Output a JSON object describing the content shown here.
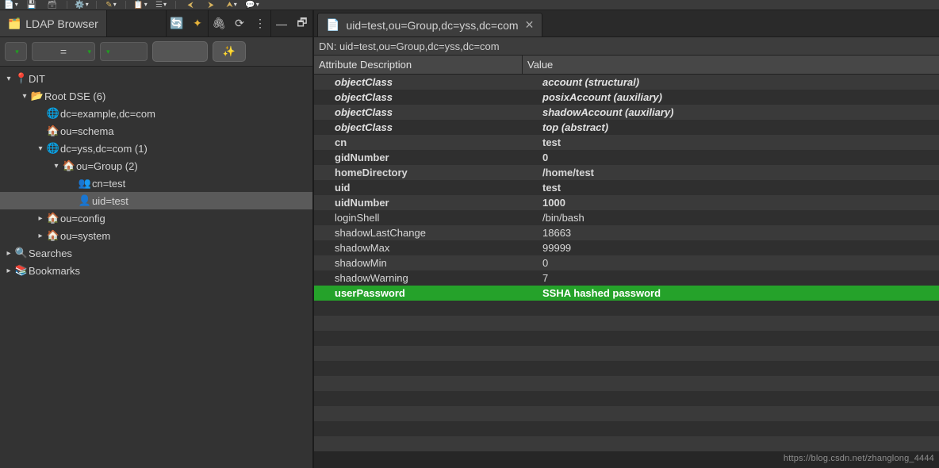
{
  "top_toolbar": {
    "icons": [
      "page",
      "save",
      "save-all",
      "gear",
      "pencil",
      "form",
      "align",
      "arrow-left",
      "arrow-right",
      "arrow-up",
      "chat"
    ]
  },
  "left": {
    "tab_title": "LDAP Browser",
    "tab_icons": {
      "refresh": "↻",
      "sync": "⇄",
      "link": "🖇",
      "cycle": "⟳",
      "menu": "⋮",
      "minimize": "—",
      "restore": "🗗"
    },
    "filter": {
      "eq_sign": "="
    }
  },
  "tree": [
    {
      "depth": 0,
      "tw": "v",
      "icon": "📍",
      "label": "DIT",
      "sel": false
    },
    {
      "depth": 1,
      "tw": "v",
      "icon": "📂",
      "label": "Root DSE (6)",
      "sel": false
    },
    {
      "depth": 2,
      "tw": "",
      "icon": "🌐",
      "label": "dc=example,dc=com",
      "sel": false
    },
    {
      "depth": 2,
      "tw": "",
      "icon": "🏠",
      "label": "ou=schema",
      "sel": false
    },
    {
      "depth": 2,
      "tw": "v",
      "icon": "🌐",
      "label": "dc=yss,dc=com (1)",
      "sel": false
    },
    {
      "depth": 3,
      "tw": "v",
      "icon": "🏠",
      "label": "ou=Group (2)",
      "sel": false
    },
    {
      "depth": 4,
      "tw": "",
      "icon": "👥",
      "label": "cn=test",
      "sel": false
    },
    {
      "depth": 4,
      "tw": "",
      "icon": "👤",
      "label": "uid=test",
      "sel": true
    },
    {
      "depth": 2,
      "tw": ">",
      "icon": "🏠",
      "label": "ou=config",
      "sel": false
    },
    {
      "depth": 2,
      "tw": ">",
      "icon": "🏠",
      "label": "ou=system",
      "sel": false
    },
    {
      "depth": 0,
      "tw": ">",
      "icon": "🔍",
      "label": "Searches",
      "sel": false
    },
    {
      "depth": 0,
      "tw": ">",
      "icon": "📚",
      "label": "Bookmarks",
      "sel": false
    }
  ],
  "editor": {
    "tab_icon": "📄",
    "tab_title": "uid=test,ou=Group,dc=yss,dc=com",
    "dn_label": "DN: uid=test,ou=Group,dc=yss,dc=com",
    "col_desc": "Attribute Description",
    "col_val": "Value"
  },
  "attrs": [
    {
      "k": "objectClass",
      "v": "account (structural)",
      "style": "bold italic"
    },
    {
      "k": "objectClass",
      "v": "posixAccount (auxiliary)",
      "style": "bold italic"
    },
    {
      "k": "objectClass",
      "v": "shadowAccount (auxiliary)",
      "style": "bold italic"
    },
    {
      "k": "objectClass",
      "v": "top (abstract)",
      "style": "bold italic"
    },
    {
      "k": "cn",
      "v": "test",
      "style": "bold"
    },
    {
      "k": "gidNumber",
      "v": "0",
      "style": "bold"
    },
    {
      "k": "homeDirectory",
      "v": "/home/test",
      "style": "bold"
    },
    {
      "k": "uid",
      "v": "test",
      "style": "bold"
    },
    {
      "k": "uidNumber",
      "v": "1000",
      "style": "bold"
    },
    {
      "k": "loginShell",
      "v": "/bin/bash",
      "style": ""
    },
    {
      "k": "shadowLastChange",
      "v": "18663",
      "style": ""
    },
    {
      "k": "shadowMax",
      "v": "99999",
      "style": ""
    },
    {
      "k": "shadowMin",
      "v": "0",
      "style": ""
    },
    {
      "k": "shadowWarning",
      "v": "7",
      "style": ""
    },
    {
      "k": "userPassword",
      "v": "SSHA hashed password",
      "style": "green"
    }
  ],
  "empty_rows": 10,
  "watermark": "https://blog.csdn.net/zhanglong_4444"
}
